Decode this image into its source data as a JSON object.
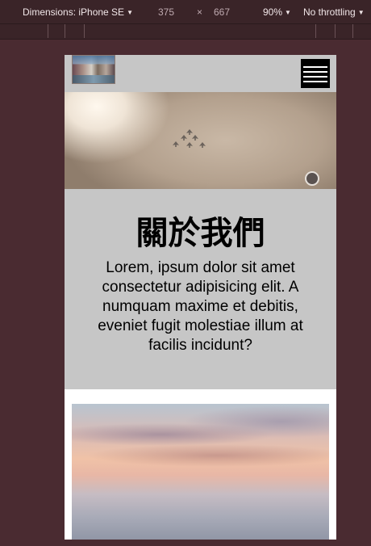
{
  "devtools": {
    "device_label": "Dimensions: iPhone SE",
    "width": "375",
    "times": "×",
    "height": "667",
    "zoom": "90%",
    "throttling": "No throttling"
  },
  "nav": {
    "logo_icon": "town-photo-logo",
    "menu_icon": "hamburger-menu-icon"
  },
  "hero": {
    "image_icon": "sky-jets-banner-image",
    "indicator_icon": "carousel-dot-icon"
  },
  "about": {
    "title": "關於我們",
    "body": "Lorem, ipsum dolor sit amet consectetur adipisicing elit. A numquam maxime et debitis, eveniet fugit molestiae illum at facilis incidunt?"
  },
  "gallery": {
    "image_icon": "sunset-clouds-photo"
  },
  "colors": {
    "page_background": "#4a2b31",
    "viewport_background": "#c6c6c6",
    "menu_button": "#000000"
  }
}
